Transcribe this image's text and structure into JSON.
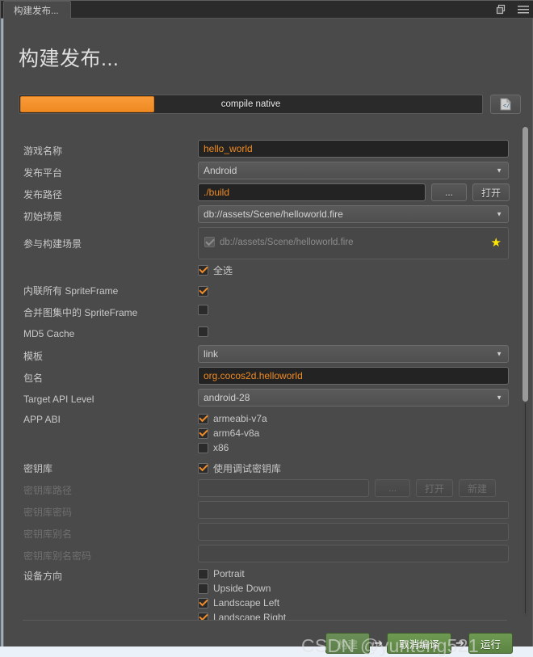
{
  "window": {
    "tab_label": "构建发布...",
    "restore_icon": "restore-window-icon",
    "menu_icon": "hamburger-menu-icon"
  },
  "dialog": {
    "title": "构建发布...",
    "progress": {
      "label": "compile native",
      "percent": 29,
      "fill_color": "#f08a22",
      "track_color": "#2a2a2a",
      "log_button_icon": "log-document-icon"
    }
  },
  "form": {
    "game_name": {
      "label": "游戏名称",
      "value": "hello_world"
    },
    "platform": {
      "label": "发布平台",
      "value": "Android"
    },
    "build_path": {
      "label": "发布路径",
      "value": "./build",
      "browse_label": "...",
      "open_label": "打开"
    },
    "start_scene": {
      "label": "初始场景",
      "value": "db://assets/Scene/helloworld.fire"
    },
    "included_scenes": {
      "label": "参与构建场景",
      "items": [
        {
          "name": "db://assets/Scene/helloworld.fire",
          "checked": true,
          "disabled": true
        }
      ],
      "star_icon": "star-icon",
      "select_all_label": "全选",
      "select_all_checked": true
    },
    "inline_all_spriteframe": {
      "label": "内联所有 SpriteFrame",
      "checked": true
    },
    "merge_atlas_spriteframe": {
      "label": "合并图集中的 SpriteFrame",
      "checked": false
    },
    "md5_cache": {
      "label": "MD5 Cache",
      "checked": false
    },
    "template": {
      "label": "模板",
      "value": "link"
    },
    "package_name": {
      "label": "包名",
      "value": "org.cocos2d.helloworld"
    },
    "target_api_level": {
      "label": "Target API Level",
      "value": "android-28"
    },
    "app_abi": {
      "label": "APP ABI",
      "options": [
        {
          "name": "armeabi-v7a",
          "checked": true
        },
        {
          "name": "arm64-v8a",
          "checked": true
        },
        {
          "name": "x86",
          "checked": false
        }
      ]
    },
    "keystore": {
      "label": "密钥库",
      "use_debug_label": "使用调试密钥库",
      "use_debug_checked": true,
      "path": {
        "label": "密钥库路径",
        "value": "",
        "disabled": true,
        "browse_label": "...",
        "open_label": "打开",
        "new_label": "新建"
      },
      "password": {
        "label": "密钥库密码",
        "value": "",
        "disabled": true
      },
      "alias": {
        "label": "密钥库别名",
        "value": "",
        "disabled": true
      },
      "alias_password": {
        "label": "密钥库别名密码",
        "value": "",
        "disabled": true
      }
    },
    "device_orientation": {
      "label": "设备方向",
      "options": [
        {
          "name": "Portrait",
          "checked": false
        },
        {
          "name": "Upside Down",
          "checked": false
        },
        {
          "name": "Landscape Left",
          "checked": true
        },
        {
          "name": "Landscape Right",
          "checked": true
        }
      ]
    }
  },
  "footer": {
    "build_label": "构建",
    "build_enabled": false,
    "arrow": "➔",
    "cancel_compile_label": "取消编译",
    "run_label": "运行",
    "accent_color": "#5c8342"
  },
  "watermark": {
    "text": "CSDN @yunteng521"
  }
}
